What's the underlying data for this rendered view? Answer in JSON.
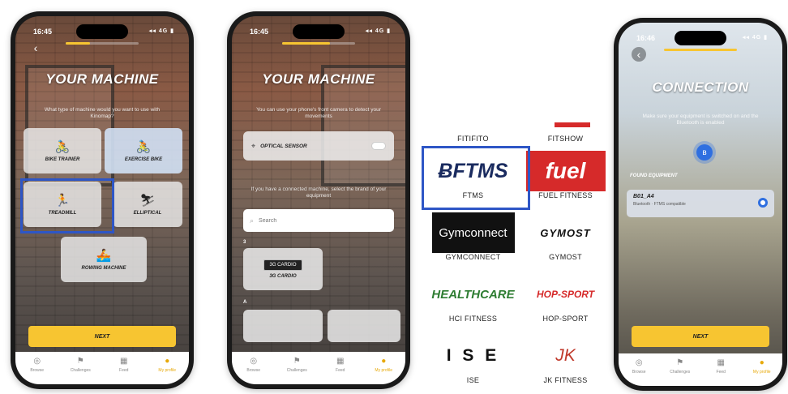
{
  "phone1": {
    "time": "16:45",
    "status_icons": "◂◂ 4G ▮",
    "progress": 0.33,
    "title": "YOUR MACHINE",
    "subtitle": "What type of machine would you want to use with Kinomap?",
    "machines": [
      {
        "label": "BIKE TRAINER",
        "icon": "🚴"
      },
      {
        "label": "EXERCISE BIKE",
        "icon": "🚴"
      },
      {
        "label": "TREADMILL",
        "icon": "🏃"
      },
      {
        "label": "ELLIPTICAL",
        "icon": "⛷"
      },
      {
        "label": "ROWING MACHINE",
        "icon": "🚣"
      }
    ],
    "next_label": "NEXT"
  },
  "phone2": {
    "time": "16:45",
    "status_icons": "◂◂ 4G ▮",
    "progress": 0.66,
    "title": "YOUR MACHINE",
    "subtitle": "You can use your phone's front camera to detect your movements",
    "sensor_label": "OPTICAL SENSOR",
    "connected_text": "If you have a connected machine, select the brand of your equipment",
    "search_placeholder": "Search",
    "letter_a": "A",
    "letter_3": "3",
    "brand_label": "3G CARDIO",
    "brand_logo": "3G CARDIO"
  },
  "grid": {
    "cells": [
      {
        "label": "FITIFITO"
      },
      {
        "label": "FITSHOW"
      },
      {
        "label": "FTMS",
        "logo": "ɃFTMS"
      },
      {
        "label": "FUEL FITNESS",
        "logo": "fuel"
      },
      {
        "label": "GYMCONNECT",
        "logo": "Gymconnect"
      },
      {
        "label": "GYMOST",
        "logo": "GYMOST"
      },
      {
        "label": "HCI FITNESS",
        "logo": "HEALTHCARE"
      },
      {
        "label": "HOP-SPORT",
        "logo": "HOP-SPORT"
      },
      {
        "label": "ISE",
        "logo": "I S E"
      },
      {
        "label": "JK FITNESS",
        "logo": "JK"
      }
    ]
  },
  "phone4": {
    "time": "16:46",
    "status_icons": "◂◂ 4G ▮",
    "progress": 1.0,
    "title": "CONNECTION",
    "subtitle": "Make sure your equipment is switched on and the Bluetooth is enabled",
    "found_label": "FOUND EQUIPMENT",
    "device_name": "B01_A4",
    "device_desc": "Bluetooth · FTMS compatible"
  },
  "tabs": [
    {
      "label": "Browse",
      "icon": "◎"
    },
    {
      "label": "Challenges",
      "icon": "⚑"
    },
    {
      "label": "Feed",
      "icon": "▦"
    },
    {
      "label": "My profile",
      "icon": "●"
    }
  ],
  "colors": {
    "accent": "#f7c531",
    "highlight": "#2e56c6",
    "bluetooth": "#2f6fe0"
  }
}
